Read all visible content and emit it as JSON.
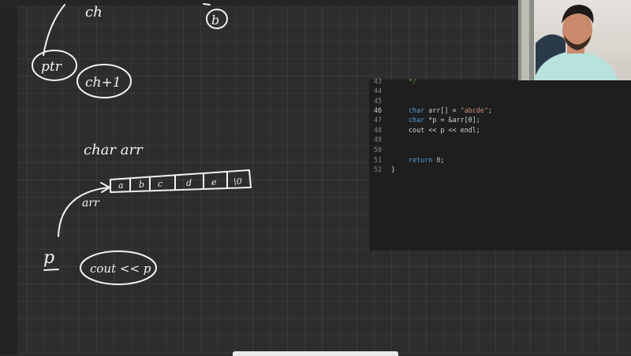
{
  "whiteboard": {
    "labels": {
      "ch": "ch",
      "b": "b",
      "ptr": "ptr",
      "ch_plus_1": "ch+1",
      "char_arr": "char arr",
      "arr": "arr",
      "p": "p",
      "cout_p": "cout << p"
    },
    "array_cells": [
      "a",
      "b",
      "c",
      "d",
      "e",
      "\\0"
    ]
  },
  "editor": {
    "lines": [
      {
        "num": "43",
        "text": "*/"
      },
      {
        "num": "44",
        "text": ""
      },
      {
        "num": "45",
        "text": ""
      },
      {
        "num": "46",
        "kw": "char",
        "rest": " arr[] = ",
        "str": "\"abcde\"",
        "tail": ";"
      },
      {
        "num": "47",
        "kw": "char",
        "rest": " *p = &arr[0];"
      },
      {
        "num": "48",
        "text": "cout << p << endl;"
      },
      {
        "num": "49",
        "text": ""
      },
      {
        "num": "50",
        "text": ""
      },
      {
        "num": "51",
        "kw": "return",
        "num_val": "0",
        "tail": ";"
      },
      {
        "num": "52",
        "text": "}"
      }
    ]
  },
  "colors": {
    "background": "#2d2d30",
    "ink": "#f2f2f2",
    "editor_bg": "#1e1e1e",
    "keyword": "#569cd6",
    "string": "#ce9178",
    "number": "#b5cea8"
  }
}
